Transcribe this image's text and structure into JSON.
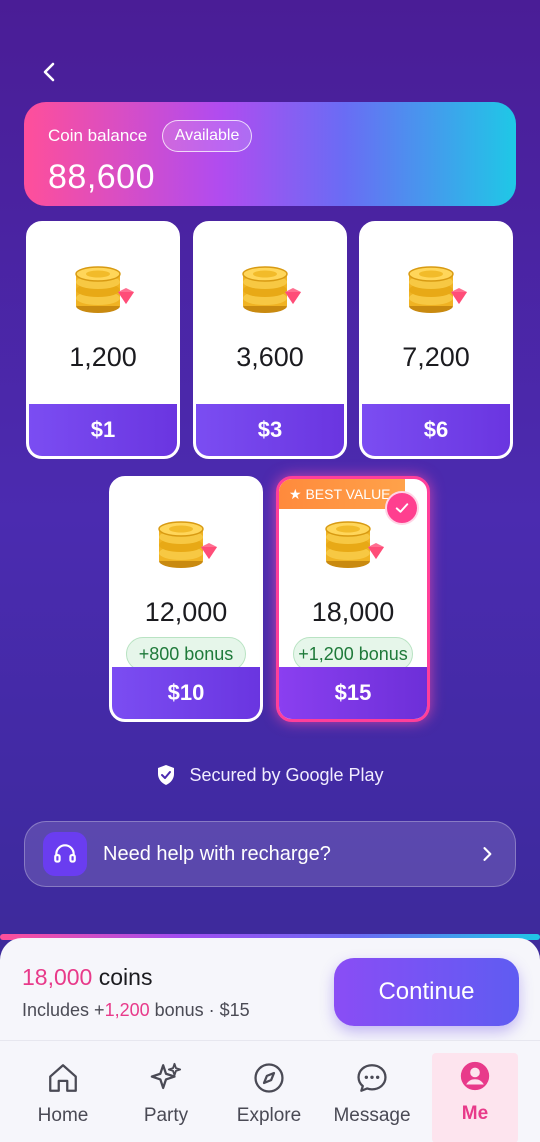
{
  "header": {
    "back_icon": "chevron-left-icon"
  },
  "balance": {
    "label": "Coin balance",
    "badge": "Available",
    "value": "88,600"
  },
  "packs": [
    {
      "amount": "1,200",
      "price": "$1"
    },
    {
      "amount": "3,600",
      "price": "$3"
    },
    {
      "amount": "7,200",
      "price": "$6"
    },
    {
      "amount": "12,000",
      "bonus": "+800 bonus",
      "price": "$10"
    },
    {
      "amount": "18,000",
      "bonus": "+1,200 bonus",
      "price": "$15",
      "ribbon": "★ BEST VALUE",
      "selected": true
    }
  ],
  "secured": {
    "text": "Secured by Google Play",
    "icon": "shield-check-icon"
  },
  "help": {
    "label": "Need help with recharge?",
    "icon": "headset-icon"
  },
  "selection": {
    "coins": "18,000",
    "coins_word": "coins",
    "includes_prefix": "Includes +",
    "bonus_amount": "1,200",
    "bonus_suffix": "bonus · $15",
    "continue_label": "Continue"
  },
  "nav": {
    "items": [
      {
        "label": "Home",
        "icon": "home-icon"
      },
      {
        "label": "Party",
        "icon": "sparkles-icon"
      },
      {
        "label": "Explore",
        "icon": "compass-icon"
      },
      {
        "label": "Message",
        "icon": "chat-bubble-icon"
      },
      {
        "label": "Me",
        "icon": "user-icon",
        "active": true
      }
    ]
  },
  "colors": {
    "accent_pink": "#e83a8a",
    "accent_purple": "#7b4df2",
    "bonus_green": "#1f7a3a"
  }
}
